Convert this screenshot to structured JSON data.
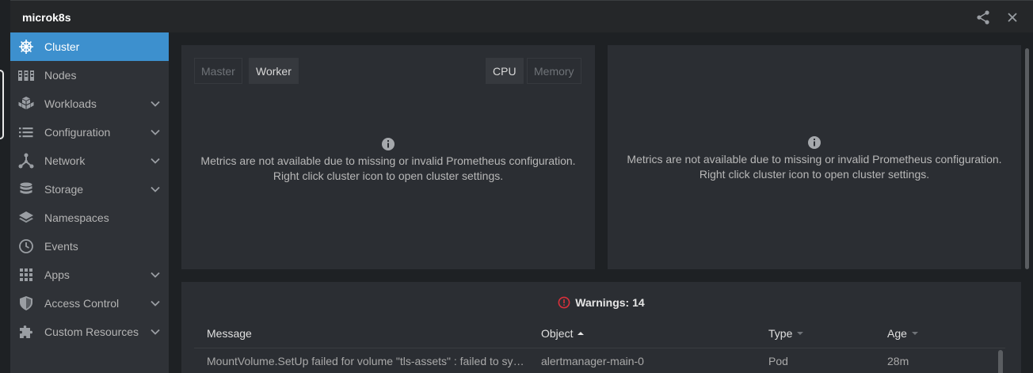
{
  "window": {
    "title": "microk8s"
  },
  "sidebar": {
    "items": [
      {
        "label": "Cluster",
        "icon": "helm-wheel-icon",
        "expandable": false,
        "active": true
      },
      {
        "label": "Nodes",
        "icon": "nodes-icon",
        "expandable": false,
        "active": false
      },
      {
        "label": "Workloads",
        "icon": "cubes-icon",
        "expandable": true,
        "active": false
      },
      {
        "label": "Configuration",
        "icon": "list-icon",
        "expandable": true,
        "active": false
      },
      {
        "label": "Network",
        "icon": "network-icon",
        "expandable": true,
        "active": false
      },
      {
        "label": "Storage",
        "icon": "database-icon",
        "expandable": true,
        "active": false
      },
      {
        "label": "Namespaces",
        "icon": "layers-icon",
        "expandable": false,
        "active": false
      },
      {
        "label": "Events",
        "icon": "clock-icon",
        "expandable": false,
        "active": false
      },
      {
        "label": "Apps",
        "icon": "grid-icon",
        "expandable": true,
        "active": false
      },
      {
        "label": "Access Control",
        "icon": "shield-icon",
        "expandable": true,
        "active": false
      },
      {
        "label": "Custom Resources",
        "icon": "puzzle-icon",
        "expandable": true,
        "active": false
      }
    ]
  },
  "metrics": {
    "node_toggle": {
      "master": "Master",
      "worker": "Worker",
      "selected": "Worker"
    },
    "resource_toggle": {
      "cpu": "CPU",
      "memory": "Memory",
      "selected": "CPU"
    },
    "left_message_line1": "Metrics are not available due to missing or invalid Prometheus configuration.",
    "left_message_line2": "Right click cluster icon to open cluster settings.",
    "right_message_line1": "Metrics are not available due to missing or invalid Prometheus configuration.",
    "right_message_line2": "Right click cluster icon to open cluster settings."
  },
  "warnings": {
    "title": "Warnings: 14",
    "columns": {
      "message": "Message",
      "object": "Object",
      "type": "Type",
      "age": "Age"
    },
    "sorted_by": "Object",
    "rows": [
      {
        "message": "MountVolume.SetUp failed for volume \"tls-assets\" : failed to sync secret cache",
        "object": "alertmanager-main-0",
        "type": "Pod",
        "age": "28m"
      }
    ]
  },
  "colors": {
    "accent": "#3d90ce",
    "warning": "#d9303b",
    "sidebar_bg": "#2f3237",
    "panel_bg": "#2b2e33"
  }
}
